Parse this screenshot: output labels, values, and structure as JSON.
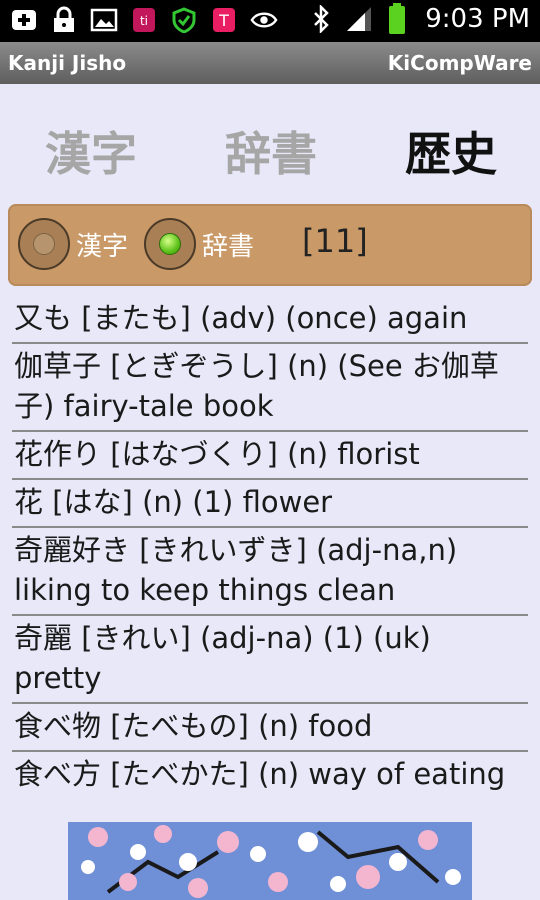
{
  "status_bar": {
    "time": "9:03 PM",
    "icons": [
      "add-icon",
      "lock-icon",
      "image-icon",
      "app-icon",
      "shield-icon",
      "app-icon-2",
      "eye-icon",
      "bluetooth-icon",
      "signal-icon",
      "battery-icon"
    ]
  },
  "app": {
    "title": "Kanji Jisho",
    "vendor": "KiCompWare"
  },
  "tabs": [
    {
      "label": "漢字",
      "active": false
    },
    {
      "label": "辞書",
      "active": false
    },
    {
      "label": "歴史",
      "active": true
    }
  ],
  "filter": {
    "options": [
      {
        "label": "漢字",
        "checked": false
      },
      {
        "label": "辞書",
        "checked": true
      }
    ],
    "count": "[11]"
  },
  "history": [
    "又も [またも] (adv) (once) again",
    "伽草子 [とぎぞうし] (n) (See お伽草子) fairy-tale book",
    "花作り [はなづくり] (n) florist",
    "花 [はな] (n) (1) flower",
    "奇麗好き [きれいずき] (adj-na,n) liking to keep things clean",
    "奇麗 [きれい] (adj-na) (1) (uk) pretty",
    "食べ物 [たべもの] (n) food",
    "食べ方 [たべかた] (n) way of eating"
  ],
  "colors": {
    "background": "#e8e8f8",
    "filter_bar": "#c99968",
    "title_bar": "#6e6e6e",
    "active_tab": "#111111",
    "inactive_tab": "#a6a6a6"
  }
}
